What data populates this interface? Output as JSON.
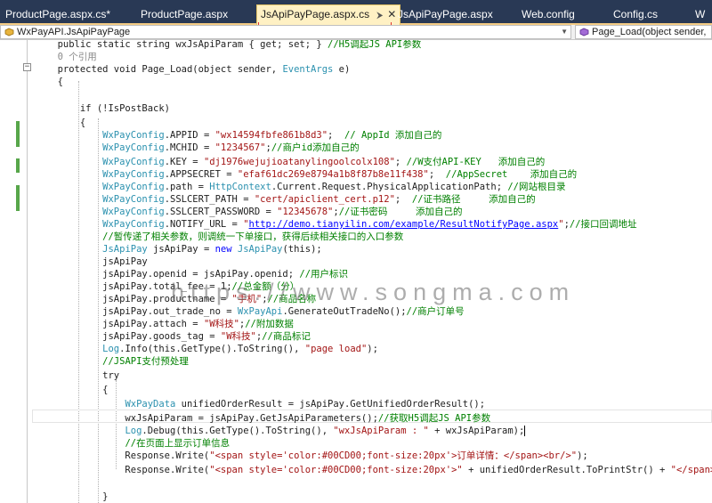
{
  "tabs": [
    {
      "label": "ProductPage.aspx.cs*",
      "active": false
    },
    {
      "label": "ProductPage.aspx",
      "active": false
    },
    {
      "label": "JsApiPayPage.aspx.cs",
      "active": true
    },
    {
      "label": "JsApiPayPage.aspx",
      "active": false
    },
    {
      "label": "Web.config",
      "active": false
    },
    {
      "label": "Config.cs",
      "active": false
    },
    {
      "label": "W",
      "active": false
    }
  ],
  "nav": {
    "left": "WxPayAPI.JsApiPayPage",
    "right": "Page_Load(object sender,"
  },
  "code_lines": [
    [
      {
        "t": "        public static string wxJsApiParam { get; set; } ",
        "c": "pl"
      },
      {
        "t": "//H5调起JS API参数",
        "c": "cm"
      }
    ],
    [
      {
        "t": "        0 个引用",
        "c": "ref"
      }
    ],
    [
      {
        "t": "        protected void Page_Load(object sender, ",
        "c": "pl"
      },
      {
        "t": "EventArgs",
        "c": "ty"
      },
      {
        "t": " e)",
        "c": "pl"
      }
    ],
    [
      {
        "t": "        {",
        "c": "pl"
      }
    ],
    [
      {
        "t": "",
        "c": "pl"
      }
    ],
    [
      {
        "t": "            if (!IsPostBack)",
        "c": "pl"
      }
    ],
    [
      {
        "t": "            {",
        "c": "pl"
      }
    ],
    [
      {
        "t": "                ",
        "c": "pl"
      },
      {
        "t": "WxPayConfig",
        "c": "ty"
      },
      {
        "t": ".APPID = ",
        "c": "pl"
      },
      {
        "t": "\"wx14594fbfe861b8d3\"",
        "c": "str"
      },
      {
        "t": ";  ",
        "c": "pl"
      },
      {
        "t": "// AppId 添加自己的",
        "c": "cm"
      }
    ],
    [
      {
        "t": "                ",
        "c": "pl"
      },
      {
        "t": "WxPayConfig",
        "c": "ty"
      },
      {
        "t": ".MCHID = ",
        "c": "pl"
      },
      {
        "t": "\"1234567\"",
        "c": "str"
      },
      {
        "t": ";",
        "c": "pl"
      },
      {
        "t": "//商户id添加自己的",
        "c": "cm"
      }
    ],
    [
      {
        "t": "                ",
        "c": "pl"
      },
      {
        "t": "WxPayConfig",
        "c": "ty"
      },
      {
        "t": ".KEY = ",
        "c": "pl"
      },
      {
        "t": "\"dj1976wejujioatanylingoolcolx108\"",
        "c": "str"
      },
      {
        "t": "; ",
        "c": "pl"
      },
      {
        "t": "//W支付API-KEY   添加自己的",
        "c": "cm"
      }
    ],
    [
      {
        "t": "                ",
        "c": "pl"
      },
      {
        "t": "WxPayConfig",
        "c": "ty"
      },
      {
        "t": ".APPSECRET = ",
        "c": "pl"
      },
      {
        "t": "\"efaf61dc269e8794a1b8f87b8e11f438\"",
        "c": "str"
      },
      {
        "t": ";  ",
        "c": "pl"
      },
      {
        "t": "//AppSecret    添加自己的",
        "c": "cm"
      }
    ],
    [
      {
        "t": "                ",
        "c": "pl"
      },
      {
        "t": "WxPayConfig",
        "c": "ty"
      },
      {
        "t": ".path = ",
        "c": "pl"
      },
      {
        "t": "HttpContext",
        "c": "ty"
      },
      {
        "t": ".Current.Request.PhysicalApplicationPath; ",
        "c": "pl"
      },
      {
        "t": "//网站根目录",
        "c": "cm"
      }
    ],
    [
      {
        "t": "                ",
        "c": "pl"
      },
      {
        "t": "WxPayConfig",
        "c": "ty"
      },
      {
        "t": ".SSLCERT_PATH = ",
        "c": "pl"
      },
      {
        "t": "\"cert/apiclient_cert.p12\"",
        "c": "str"
      },
      {
        "t": ";  ",
        "c": "pl"
      },
      {
        "t": "//证书路径     添加自己的",
        "c": "cm"
      }
    ],
    [
      {
        "t": "                ",
        "c": "pl"
      },
      {
        "t": "WxPayConfig",
        "c": "ty"
      },
      {
        "t": ".SSLCERT_PASSWORD = ",
        "c": "pl"
      },
      {
        "t": "\"12345678\"",
        "c": "str"
      },
      {
        "t": ";",
        "c": "pl"
      },
      {
        "t": "//证书密码     添加自己的",
        "c": "cm"
      }
    ],
    [
      {
        "t": "                ",
        "c": "pl"
      },
      {
        "t": "WxPayConfig",
        "c": "ty"
      },
      {
        "t": ".NOTIFY_URL = ",
        "c": "pl"
      },
      {
        "t": "\"",
        "c": "str"
      },
      {
        "t": "http://demo.tianyilin.com/example/ResultNotifyPage.aspx",
        "c": "lnk"
      },
      {
        "t": "\"",
        "c": "str"
      },
      {
        "t": ";",
        "c": "pl"
      },
      {
        "t": "//接口回调地址",
        "c": "cm"
      }
    ],
    [
      {
        "t": "                ",
        "c": "pl"
      },
      {
        "t": "//暂传递了相关参数，则调统一下单接口，获得后续相关接口的入口参数",
        "c": "cm"
      }
    ],
    [
      {
        "t": "                ",
        "c": "pl"
      },
      {
        "t": "JsApiPay",
        "c": "ty"
      },
      {
        "t": " jsApiPay = ",
        "c": "pl"
      },
      {
        "t": "new",
        "c": "kw"
      },
      {
        "t": " ",
        "c": "pl"
      },
      {
        "t": "JsApiPay",
        "c": "ty"
      },
      {
        "t": "(this);",
        "c": "pl"
      }
    ],
    [
      {
        "t": "                jsApiPay",
        "c": "pl"
      }
    ],
    [
      {
        "t": "                jsApiPay.openid = jsApiPay.openid; ",
        "c": "pl"
      },
      {
        "t": "//用户标识",
        "c": "cm"
      }
    ],
    [
      {
        "t": "                jsApiPay.total_fee = 1;",
        "c": "pl"
      },
      {
        "t": "//总金额（分）",
        "c": "cm"
      }
    ],
    [
      {
        "t": "                jsApiPay.productname = ",
        "c": "pl"
      },
      {
        "t": "\"手机\"",
        "c": "str"
      },
      {
        "t": ";",
        "c": "pl"
      },
      {
        "t": "//商品名称",
        "c": "cm"
      }
    ],
    [
      {
        "t": "                jsApiPay.out_trade_no = ",
        "c": "pl"
      },
      {
        "t": "WxPayApi",
        "c": "ty"
      },
      {
        "t": ".GenerateOutTradeNo();",
        "c": "pl"
      },
      {
        "t": "//商户订单号",
        "c": "cm"
      }
    ],
    [
      {
        "t": "                jsApiPay.attach = ",
        "c": "pl"
      },
      {
        "t": "\"W科技\"",
        "c": "str"
      },
      {
        "t": ";",
        "c": "pl"
      },
      {
        "t": "//附加数据",
        "c": "cm"
      }
    ],
    [
      {
        "t": "                jsApiPay.goods_tag = ",
        "c": "pl"
      },
      {
        "t": "\"W科技\"",
        "c": "str"
      },
      {
        "t": ";",
        "c": "pl"
      },
      {
        "t": "//商品标记",
        "c": "cm"
      }
    ],
    [
      {
        "t": "                ",
        "c": "pl"
      },
      {
        "t": "Log",
        "c": "ty"
      },
      {
        "t": ".Info(this.GetType().ToString(), ",
        "c": "pl"
      },
      {
        "t": "\"page load\"",
        "c": "str"
      },
      {
        "t": ");",
        "c": "pl"
      }
    ],
    [
      {
        "t": "                ",
        "c": "pl"
      },
      {
        "t": "//JSAPI支付预处理",
        "c": "cm"
      }
    ],
    [
      {
        "t": "                try",
        "c": "pl"
      }
    ],
    [
      {
        "t": "                {",
        "c": "pl"
      }
    ],
    [
      {
        "t": "                    ",
        "c": "pl"
      },
      {
        "t": "WxPayData",
        "c": "ty"
      },
      {
        "t": " unifiedOrderResult = jsApiPay.GetUnifiedOrderResult();",
        "c": "pl"
      }
    ],
    [
      {
        "t": "                    wxJsApiParam = jsApiPay.GetJsApiParameters();",
        "c": "pl"
      },
      {
        "t": "//获取H5调起JS API参数",
        "c": "cm"
      }
    ],
    [
      {
        "t": "                    ",
        "c": "pl"
      },
      {
        "t": "Log",
        "c": "ty"
      },
      {
        "t": ".Debug(this.GetType().ToString(), ",
        "c": "pl"
      },
      {
        "t": "\"wxJsApiParam : \"",
        "c": "str"
      },
      {
        "t": " + wxJsApiParam);",
        "c": "pl"
      },
      {
        "t": "",
        "c": "caret"
      }
    ],
    [
      {
        "t": "                    ",
        "c": "pl"
      },
      {
        "t": "//在页面上显示订单信息",
        "c": "cm"
      }
    ],
    [
      {
        "t": "                    Response.Write(",
        "c": "pl"
      },
      {
        "t": "\"<span style='color:#00CD00;font-size:20px'>订单详情：</span><br/>\"",
        "c": "str"
      },
      {
        "t": ");",
        "c": "pl"
      }
    ],
    [
      {
        "t": "                    Response.Write(",
        "c": "pl"
      },
      {
        "t": "\"<span style='color:#00CD00;font-size:20px'>\"",
        "c": "str"
      },
      {
        "t": " + unifiedOrderResult.ToPrintStr() + ",
        "c": "pl"
      },
      {
        "t": "\"</span>\"",
        "c": "str"
      },
      {
        "t": ");",
        "c": "pl"
      }
    ],
    [
      {
        "t": "",
        "c": "pl"
      }
    ],
    [
      {
        "t": "                }",
        "c": "pl"
      }
    ],
    [
      {
        "t": "                catch (",
        "c": "pl"
      },
      {
        "t": "Exception",
        "c": "ty"
      },
      {
        "t": " ex)",
        "c": "pl"
      }
    ],
    [
      {
        "t": "                {",
        "c": "pl"
      }
    ]
  ],
  "watermark": "https://www.songma.com"
}
